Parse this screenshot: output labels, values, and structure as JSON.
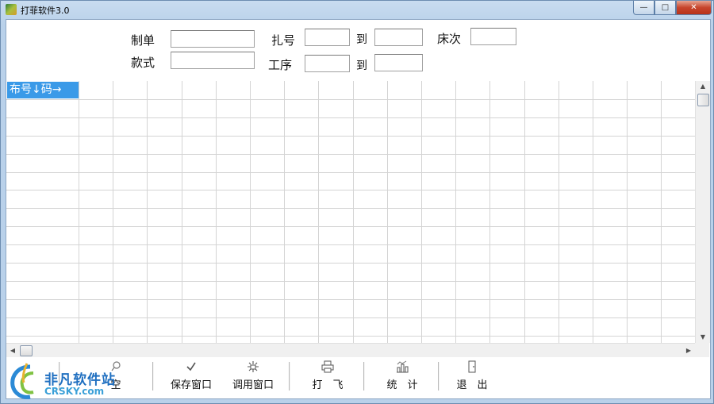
{
  "window": {
    "title": "打菲软件3.0",
    "buttons": {
      "minimize": "—",
      "maximize": "□",
      "close": "✕"
    }
  },
  "form": {
    "order_label": "制单",
    "order_value": "",
    "style_label": "款式",
    "style_value": "",
    "bundle_label": "扎号",
    "bundle_from": "",
    "bundle_to_label": "到",
    "bundle_to": "",
    "bed_label": "床次",
    "bed_value": "",
    "process_label": "工序",
    "process_from": "",
    "process_to_label": "到",
    "process_to": ""
  },
  "grid": {
    "header_cell": "布号↓码→",
    "columns": 20,
    "rows": 14
  },
  "toolbar": {
    "clear_label": "空",
    "save_window_label": "保存窗口",
    "load_window_label": "调用窗口",
    "print_label": "打　飞",
    "stats_label": "统　计",
    "exit_label": "退　出"
  },
  "icons": {
    "clear": "eraser-icon",
    "save": "checkmark-icon",
    "load": "sparkle-icon",
    "print": "printer-icon",
    "stats": "chart-icon",
    "exit": "door-icon"
  },
  "watermark": {
    "cn": "非凡软件站",
    "en": "CRSKY.com"
  },
  "colors": {
    "header_bg": "#3a9ae8",
    "title_gradient": "#b9d1ea"
  }
}
